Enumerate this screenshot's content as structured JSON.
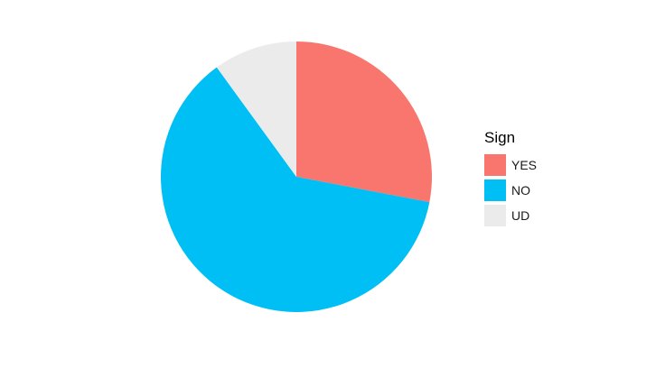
{
  "chart_data": {
    "type": "pie",
    "legend": {
      "title": "Sign",
      "position": "right"
    },
    "slices": [
      {
        "label": "YES",
        "value": 28,
        "color": "#F8766D"
      },
      {
        "label": "NO",
        "value": 62,
        "color": "#00BFF5"
      },
      {
        "label": "UD",
        "value": 10,
        "color": "#EBEBEB"
      }
    ],
    "start_angle_deg": 0,
    "direction": "clockwise"
  }
}
